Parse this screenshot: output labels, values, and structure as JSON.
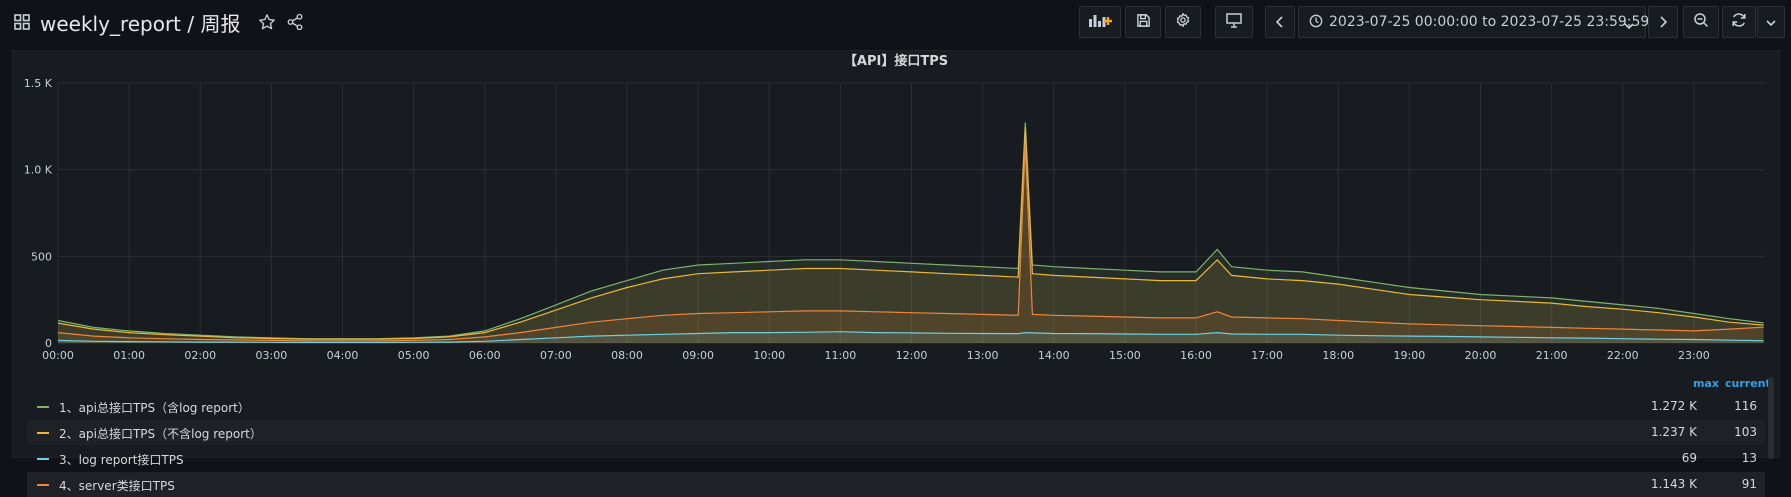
{
  "header": {
    "title": "weekly_report / 周报",
    "time_range": "2023-07-25 00:00:00 to 2023-07-25 23:59:59",
    "icons": {
      "add_panel": "add-panel-icon",
      "save": "save-icon",
      "settings": "gear-icon",
      "view_mode": "monitor-icon",
      "prev": "chevron-left-icon",
      "clock": "clock-icon",
      "next": "chevron-right-icon",
      "zoom_out": "zoom-out-icon",
      "refresh": "refresh-icon",
      "refresh_menu": "chevron-down-icon"
    }
  },
  "panel": {
    "title": "【API】接口TPS"
  },
  "legend": {
    "columns": {
      "max": "max",
      "current": "current"
    },
    "items": [
      {
        "name": "1、api总接口TPS（含log report）",
        "max": "1.272 K",
        "current": "116",
        "color": "#7eb26d"
      },
      {
        "name": "2、api总接口TPS（不含log report）",
        "max": "1.237 K",
        "current": "103",
        "color": "#eab839"
      },
      {
        "name": "3、log report接口TPS",
        "max": "69",
        "current": "13",
        "color": "#6ed0e0"
      },
      {
        "name": "4、server类接口TPS",
        "max": "1.143 K",
        "current": "91",
        "color": "#ef843c"
      }
    ]
  },
  "chart_data": {
    "type": "area",
    "title": "【API】接口TPS",
    "xlabel": "",
    "ylabel": "",
    "ylim": [
      0,
      1500
    ],
    "y_ticks": [
      0,
      500,
      1000,
      1500
    ],
    "y_tick_labels": [
      "0",
      "500",
      "1.0 K",
      "1.5 K"
    ],
    "x_tick_labels": [
      "00:00",
      "01:00",
      "02:00",
      "03:00",
      "04:00",
      "05:00",
      "06:00",
      "07:00",
      "08:00",
      "09:00",
      "10:00",
      "11:00",
      "12:00",
      "13:00",
      "14:00",
      "15:00",
      "16:00",
      "17:00",
      "18:00",
      "19:00",
      "20:00",
      "21:00",
      "22:00",
      "23:00"
    ],
    "x_hours": [
      0,
      0.5,
      1,
      1.5,
      2,
      2.5,
      3,
      3.5,
      4,
      4.5,
      5,
      5.5,
      6,
      6.5,
      7,
      7.5,
      8,
      8.5,
      9,
      9.5,
      10,
      10.5,
      11,
      11.5,
      12,
      12.5,
      13,
      13.5,
      13.6,
      13.7,
      14,
      14.5,
      15,
      15.5,
      16,
      16.3,
      16.5,
      17,
      17.5,
      18,
      18.5,
      19,
      19.5,
      20,
      20.5,
      21,
      21.5,
      22,
      22.5,
      23,
      23.5,
      23.98
    ],
    "grid": true,
    "legend": "bottom",
    "series": [
      {
        "name": "1、api总接口TPS（含log report）",
        "values": [
          130,
          90,
          70,
          55,
          45,
          35,
          30,
          25,
          25,
          25,
          30,
          40,
          70,
          140,
          220,
          300,
          360,
          420,
          450,
          460,
          470,
          480,
          480,
          470,
          460,
          450,
          440,
          430,
          1272,
          450,
          440,
          430,
          420,
          410,
          410,
          540,
          440,
          420,
          410,
          380,
          350,
          320,
          300,
          280,
          270,
          260,
          240,
          220,
          200,
          170,
          140,
          116
        ]
      },
      {
        "name": "2、api总接口TPS（不含log report）",
        "values": [
          115,
          80,
          60,
          48,
          40,
          30,
          26,
          22,
          22,
          22,
          26,
          35,
          60,
          120,
          190,
          260,
          320,
          370,
          400,
          410,
          420,
          430,
          430,
          420,
          410,
          400,
          390,
          380,
          1237,
          400,
          390,
          380,
          370,
          360,
          360,
          480,
          390,
          370,
          360,
          340,
          310,
          280,
          265,
          250,
          240,
          230,
          210,
          195,
          175,
          150,
          120,
          103
        ]
      },
      {
        "name": "3、log report接口TPS",
        "values": [
          15,
          10,
          8,
          7,
          5,
          5,
          4,
          3,
          3,
          3,
          4,
          5,
          10,
          20,
          30,
          40,
          45,
          50,
          55,
          60,
          60,
          62,
          65,
          60,
          58,
          56,
          55,
          54,
          60,
          58,
          55,
          54,
          52,
          50,
          50,
          60,
          52,
          50,
          50,
          45,
          42,
          40,
          38,
          35,
          33,
          30,
          28,
          25,
          22,
          20,
          16,
          13
        ]
      },
      {
        "name": "4、server类接口TPS",
        "values": [
          60,
          40,
          30,
          25,
          20,
          18,
          15,
          12,
          12,
          12,
          15,
          20,
          35,
          60,
          90,
          120,
          140,
          160,
          170,
          175,
          180,
          185,
          185,
          180,
          175,
          170,
          165,
          160,
          1143,
          165,
          160,
          155,
          150,
          145,
          145,
          180,
          150,
          145,
          140,
          130,
          120,
          110,
          105,
          100,
          95,
          90,
          85,
          80,
          75,
          70,
          80,
          91
        ]
      }
    ]
  }
}
